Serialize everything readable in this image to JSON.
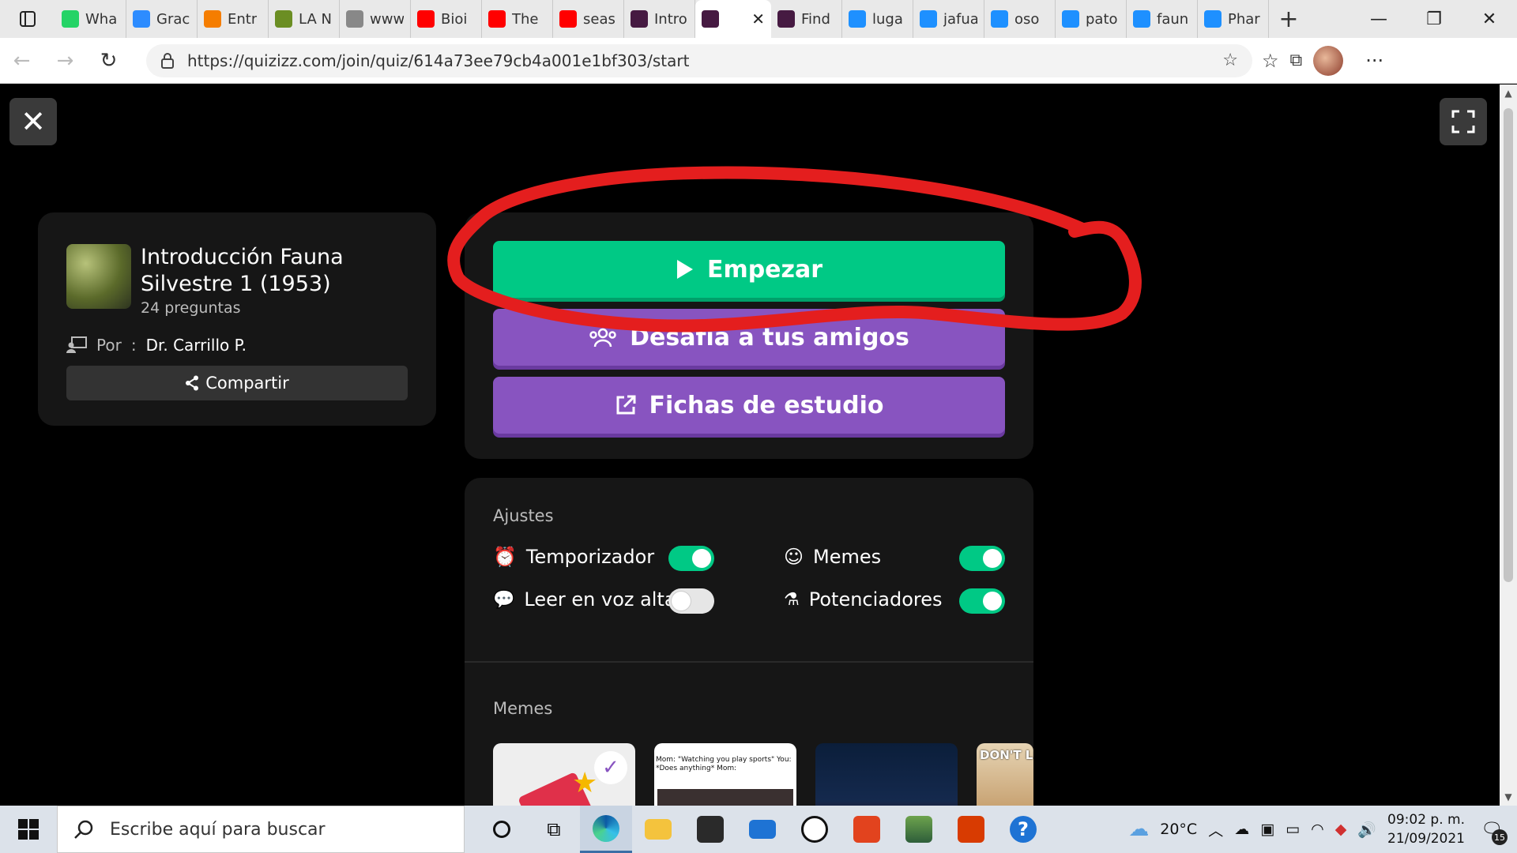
{
  "browser": {
    "tabs": [
      {
        "label": "Wha",
        "icon": "whatsapp-icon",
        "color": "#25d366"
      },
      {
        "label": "Grac",
        "icon": "zoom-icon",
        "color": "#2d8cff"
      },
      {
        "label": "Entr",
        "icon": "blogger-icon",
        "color": "#f57d00"
      },
      {
        "label": "LA N",
        "icon": "leaf-icon",
        "color": "#6b8e23"
      },
      {
        "label": "www",
        "icon": "document-icon",
        "color": "#888888"
      },
      {
        "label": "Bioi",
        "icon": "youtube-icon",
        "color": "#ff0000"
      },
      {
        "label": "The",
        "icon": "youtube-icon",
        "color": "#ff0000"
      },
      {
        "label": "seas",
        "icon": "youtube-icon",
        "color": "#ff0000"
      },
      {
        "label": "Intro",
        "icon": "quizizz-icon",
        "color": "#461a42"
      },
      {
        "label": "",
        "icon": "quizizz-icon",
        "color": "#461a42",
        "active": true,
        "close": "✕"
      },
      {
        "label": "Find",
        "icon": "quizizz-icon",
        "color": "#461a42"
      },
      {
        "label": "luga",
        "icon": "bing-icon",
        "color": "#1e90ff"
      },
      {
        "label": "jafua",
        "icon": "bing-icon",
        "color": "#1e90ff"
      },
      {
        "label": "oso",
        "icon": "bing-icon",
        "color": "#1e90ff"
      },
      {
        "label": "pato",
        "icon": "bing-icon",
        "color": "#1e90ff"
      },
      {
        "label": "faun",
        "icon": "bing-icon",
        "color": "#1e90ff"
      },
      {
        "label": "Phar",
        "icon": "bing-icon",
        "color": "#1e90ff"
      }
    ],
    "url": "https://quizizz.com/join/quiz/614a73ee79cb4a001e1bf303/start"
  },
  "quiz": {
    "title": "Introducción Fauna Silvestre 1 (1953)",
    "count": "24 preguntas",
    "by_label": "Por",
    "by_sep": ":",
    "author": "Dr. Carrillo P.",
    "share_label": "Compartir"
  },
  "actions": {
    "start_label": "Empezar",
    "challenge_label": "Desafía a tus amigos",
    "flashcards_label": "Fichas de estudio"
  },
  "settings": {
    "title": "Ajustes",
    "timer": {
      "label": "Temporizador",
      "on": true
    },
    "memes": {
      "label": "Memes",
      "on": true
    },
    "read_aloud": {
      "label": "Leer en voz alta",
      "on": false
    },
    "powerups": {
      "label": "Potenciadores",
      "on": true
    }
  },
  "memes_section": {
    "title": "Memes",
    "meme2_text": "Mom: \"Watching you play sports\" You: *Does anything* Mom:",
    "meme4_text": "DON'T LIK"
  },
  "annotation": {
    "color": "#e41e1e"
  },
  "taskbar": {
    "search_placeholder": "Escribe aquí para buscar",
    "temperature": "20°C",
    "time": "09:02 p. m.",
    "date": "21/09/2021",
    "notifications": "15"
  },
  "colors": {
    "green": "#00c985",
    "purple": "#8854c0",
    "card": "#161616"
  }
}
